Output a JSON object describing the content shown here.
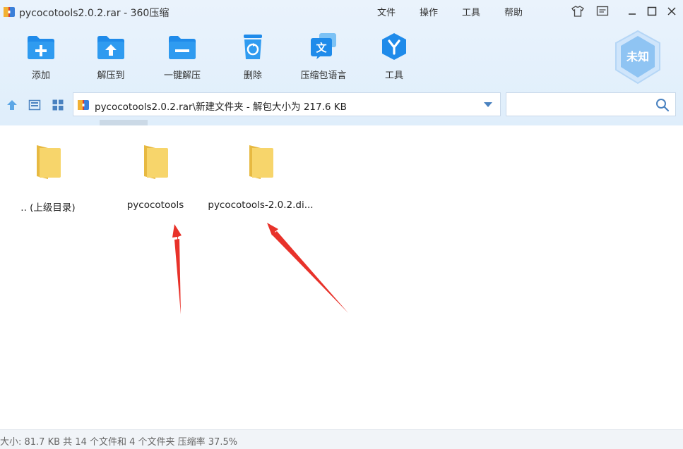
{
  "window": {
    "title": "pycocotools2.0.2.rar - 360压缩",
    "app_icon": "zip-archive-icon"
  },
  "menu": {
    "items": [
      "文件",
      "操作",
      "工具",
      "帮助"
    ]
  },
  "toolbar": {
    "items": [
      {
        "label": "添加",
        "icon": "add-folder-icon"
      },
      {
        "label": "解压到",
        "icon": "extract-to-icon"
      },
      {
        "label": "一键解压",
        "icon": "one-click-extract-icon"
      },
      {
        "label": "删除",
        "icon": "recycle-bin-icon"
      },
      {
        "label": "压缩包语言",
        "icon": "language-icon"
      },
      {
        "label": "工具",
        "icon": "tools-icon"
      }
    ],
    "badge_text": "未知"
  },
  "address": {
    "path": "pycocotools2.0.2.rar\\新建文件夹 - 解包大小为 217.6 KB"
  },
  "search": {
    "placeholder": ""
  },
  "files": [
    {
      "name": ".. (上级目录)",
      "icon": "folder-icon"
    },
    {
      "name": "pycocotools",
      "icon": "folder-icon"
    },
    {
      "name": "pycocotools-2.0.2.di...",
      "icon": "folder-icon"
    }
  ],
  "status": {
    "text": "大小: 81.7 KB 共 14 个文件和 4 个文件夹 压缩率 37.5%"
  },
  "colors": {
    "accent": "#1f8bea",
    "folder": "#f7d56b",
    "arrow": "#e8322a",
    "chrome_bg": "#e4f0fb"
  }
}
